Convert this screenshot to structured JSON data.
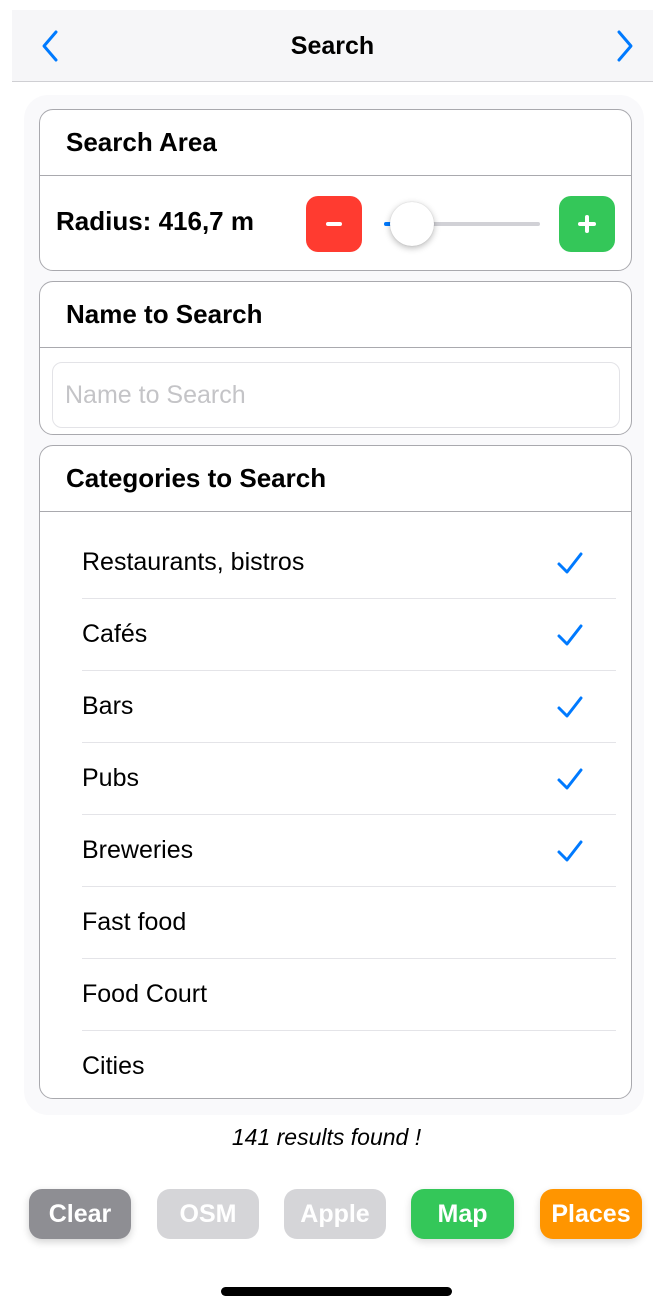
{
  "nav": {
    "title": "Search",
    "back_icon": "chevron-left-icon",
    "forward_icon": "chevron-right-icon",
    "accent": "#007aff"
  },
  "search_area": {
    "header": "Search Area",
    "radius_label": "Radius: 416,7 m",
    "slider_level": 0.04,
    "minus_color": "#ff3b30",
    "plus_color": "#34c759"
  },
  "name_search": {
    "header": "Name to Search",
    "value": "",
    "placeholder": "Name to Search"
  },
  "categories": {
    "header": "Categories to Search",
    "items": [
      {
        "label": "Restaurants, bistros",
        "checked": true
      },
      {
        "label": "Cafés",
        "checked": true
      },
      {
        "label": "Bars",
        "checked": true
      },
      {
        "label": "Pubs",
        "checked": true
      },
      {
        "label": "Breweries",
        "checked": true
      },
      {
        "label": "Fast food",
        "checked": false
      },
      {
        "label": "Food Court",
        "checked": false
      },
      {
        "label": "Cities",
        "checked": false
      }
    ]
  },
  "results_text": "141 results found !",
  "buttons": {
    "clear": "Clear",
    "osm": "OSM",
    "apple": "Apple",
    "map": "Map",
    "places": "Places"
  }
}
